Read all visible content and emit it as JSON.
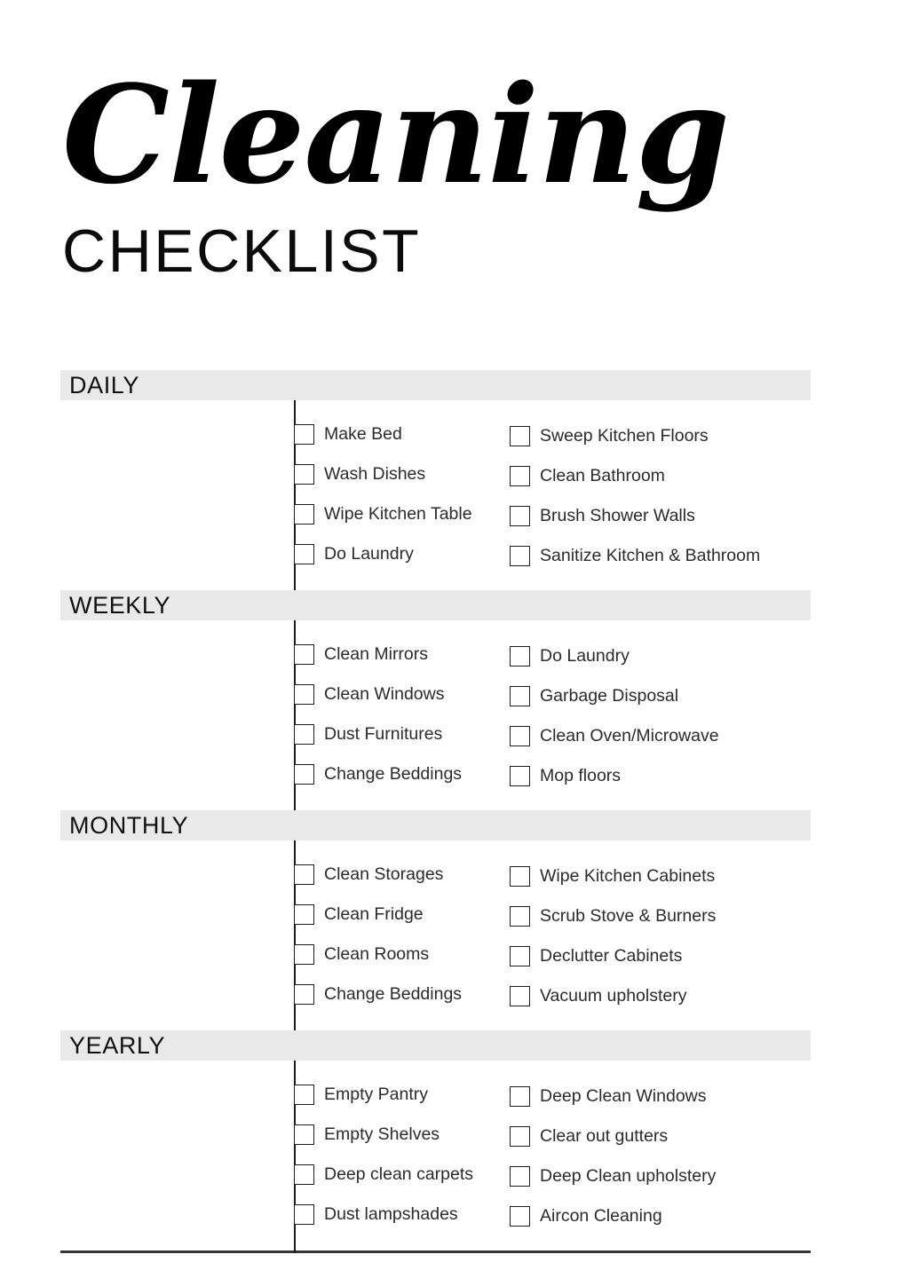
{
  "title": {
    "script": "Cleaning",
    "subtitle": "CHECKLIST"
  },
  "colors": {
    "band": "#e9e9e9",
    "rule": "#1d1d1d",
    "text": "#2b2b2b",
    "heading": "#111111",
    "background": "#ffffff"
  },
  "sections": [
    {
      "heading": "DAILY",
      "column_left": [
        {
          "label": "Make Bed",
          "checked": false
        },
        {
          "label": "Wash Dishes",
          "checked": false
        },
        {
          "label": "Wipe Kitchen Table",
          "checked": false
        },
        {
          "label": "Do Laundry",
          "checked": false
        }
      ],
      "column_right": [
        {
          "label": "Sweep Kitchen Floors",
          "checked": false
        },
        {
          "label": "Clean Bathroom",
          "checked": false
        },
        {
          "label": "Brush Shower Walls",
          "checked": false
        },
        {
          "label": "Sanitize Kitchen & Bathroom",
          "checked": false
        }
      ]
    },
    {
      "heading": "WEEKLY",
      "column_left": [
        {
          "label": "Clean Mirrors",
          "checked": false
        },
        {
          "label": "Clean Windows",
          "checked": false
        },
        {
          "label": "Dust Furnitures",
          "checked": false
        },
        {
          "label": "Change Beddings",
          "checked": false
        }
      ],
      "column_right": [
        {
          "label": "Do Laundry",
          "checked": false
        },
        {
          "label": "Garbage Disposal",
          "checked": false
        },
        {
          "label": "Clean Oven/Microwave",
          "checked": false
        },
        {
          "label": "Mop floors",
          "checked": false
        }
      ]
    },
    {
      "heading": "MONTHLY",
      "column_left": [
        {
          "label": "Clean Storages",
          "checked": false
        },
        {
          "label": "Clean Fridge",
          "checked": false
        },
        {
          "label": "Clean Rooms",
          "checked": false
        },
        {
          "label": "Change Beddings",
          "checked": false
        }
      ],
      "column_right": [
        {
          "label": "Wipe Kitchen Cabinets",
          "checked": false
        },
        {
          "label": "Scrub Stove & Burners",
          "checked": false
        },
        {
          "label": "Declutter Cabinets",
          "checked": false
        },
        {
          "label": "Vacuum upholstery",
          "checked": false
        }
      ]
    },
    {
      "heading": "YEARLY",
      "column_left": [
        {
          "label": "Empty Pantry",
          "checked": false
        },
        {
          "label": "Empty Shelves",
          "checked": false
        },
        {
          "label": "Deep clean carpets",
          "checked": false
        },
        {
          "label": "Dust lampshades",
          "checked": false
        }
      ],
      "column_right": [
        {
          "label": "Deep Clean Windows",
          "checked": false
        },
        {
          "label": "Clear out gutters",
          "checked": false
        },
        {
          "label": "Deep Clean upholstery",
          "checked": false
        },
        {
          "label": "Aircon Cleaning",
          "checked": false
        }
      ]
    }
  ]
}
